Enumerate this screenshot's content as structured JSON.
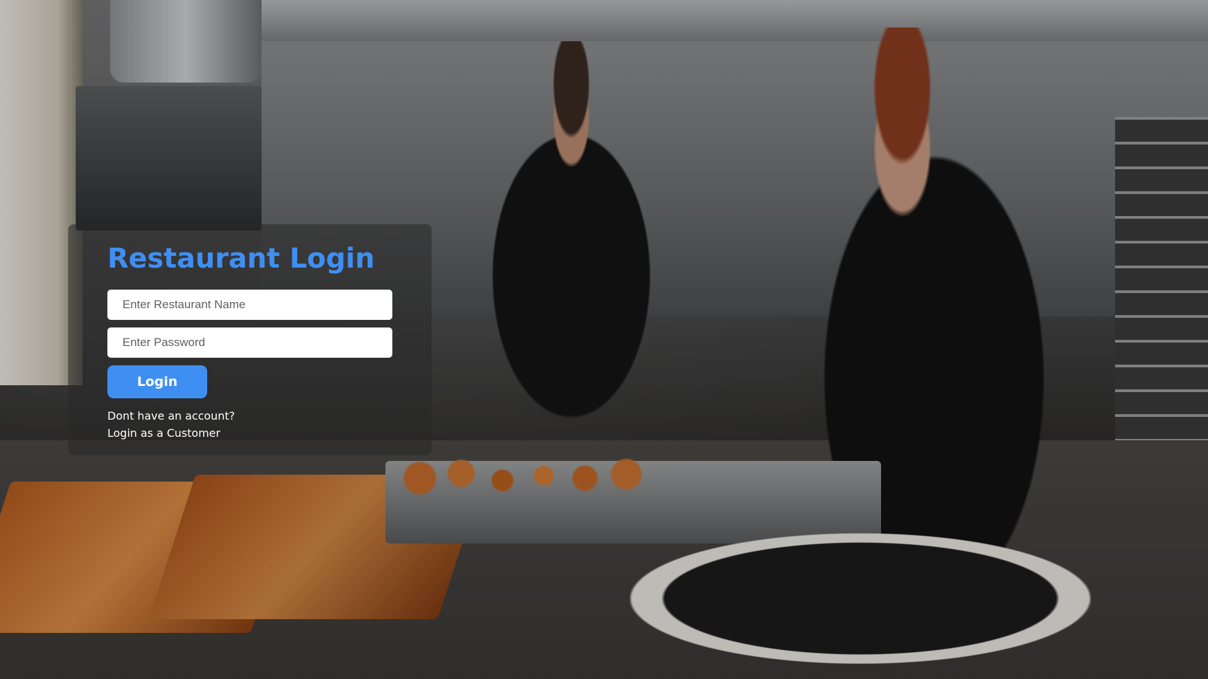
{
  "login": {
    "title": "Restaurant Login",
    "restaurant_name_placeholder": "Enter Restaurant Name",
    "password_placeholder": "Enter Password",
    "login_button": "Login",
    "no_account_text": "Dont have an account?",
    "customer_link": "Login as a Customer"
  },
  "colors": {
    "accent": "#3f8ff2",
    "panel": "rgba(40, 40, 40, 0.55)",
    "text": "#ffffff"
  }
}
